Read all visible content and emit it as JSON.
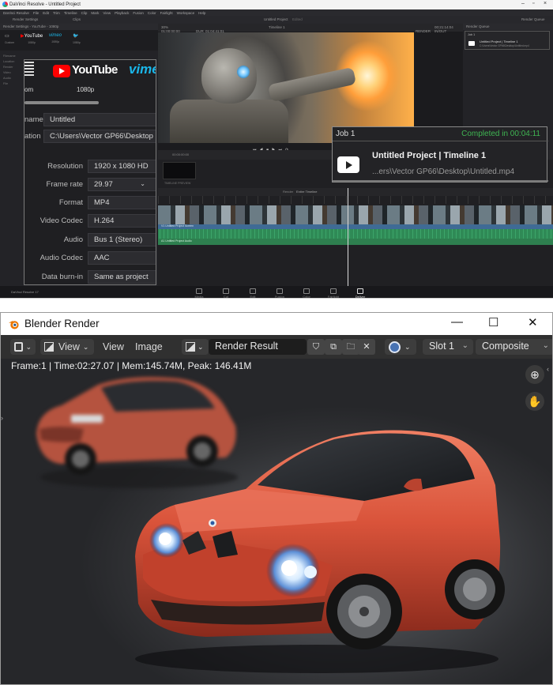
{
  "resolve": {
    "window_title": "DaVinci Resolve - Untitled Project",
    "menu": [
      "DaVinci Resolve",
      "File",
      "Edit",
      "Trim",
      "Timeline",
      "Clip",
      "Mark",
      "View",
      "Playback",
      "Fusion",
      "Color",
      "Fairlight",
      "Workspace",
      "Help"
    ],
    "toolbar": {
      "render_settings": "Render Settings",
      "clips": "Clips",
      "project_title": "Untitled Project",
      "edited": "Edited",
      "render_queue": "Render Queue"
    },
    "left_header": "Render Settings - YouTube - 1080p",
    "presets": [
      {
        "name": "YouTube",
        "sub": "1080p"
      },
      {
        "name": "vimeo",
        "sub": "1080p"
      },
      {
        "name": "Twitter",
        "sub": "1080p"
      }
    ],
    "preset_custom_label": "Custom",
    "left_list": [
      "Filename",
      "Location",
      "Render",
      "Video",
      "Audio",
      "File"
    ],
    "viewer": {
      "zoom": "30%",
      "timeline_name": "Timeline 1",
      "source_tc": "01:00:00:00",
      "duration_label": "DUR",
      "duration_tc": "01:04:41:01",
      "record_tc": "00:21:14:04",
      "render_label": "RENDER",
      "render_range": "IN/OUT",
      "playback_tc": "00:00:00:00"
    },
    "timeline": {
      "scale_label": "Render",
      "range_label": "Entire Timeline",
      "track1": "V1 Untitled Project Screen",
      "track2": "A1 Untitled Project Audio",
      "preview_label": "TIMELINE PREVIEW"
    },
    "queue": {
      "header": "Render Queue",
      "job_name": "Job 1",
      "job_title": "Untitled Project | Timeline 1",
      "job_path": "C:\\Users\\Vector GP66\\Desktop\\Untitled.mp4",
      "job_status": "Completed in 00:04:11"
    },
    "pages": [
      "Media",
      "Cut",
      "Edit",
      "Fusion",
      "Color",
      "Fairlight",
      "Deliver"
    ],
    "status_app": "DaVinci Resolve 17"
  },
  "zoom_settings": {
    "youtube_word": "YouTube",
    "vimeo_word": "vime",
    "sub_left": "om",
    "sub_mid": "1080p",
    "rows": [
      {
        "label": "name",
        "value": "Untitled"
      },
      {
        "label": "ation",
        "value": "C:\\Users\\Vector GP66\\Desktop"
      },
      {
        "label": "Resolution",
        "value": "1920 x 1080 HD"
      },
      {
        "label": "Frame rate",
        "value": "29.97"
      },
      {
        "label": "Format",
        "value": "MP4"
      },
      {
        "label": "Video Codec",
        "value": "H.264"
      },
      {
        "label": "Audio",
        "value": "Bus 1 (Stereo)"
      },
      {
        "label": "Audio Codec",
        "value": "AAC"
      },
      {
        "label": "Data burn-in",
        "value": "Same as project"
      }
    ],
    "frame_rate_caret": "⌄"
  },
  "zoom_job": {
    "name": "Job 1",
    "status": "Completed in 00:04:11",
    "title": "Untitled Project | Timeline 1",
    "path": "...ers\\Vector GP66\\Desktop\\Untitled.mp4"
  },
  "blender": {
    "window_title": "Blender Render",
    "minimize": "—",
    "maximize": "☐",
    "close": "✕",
    "header": {
      "view_menu": "View",
      "view_plain": "View",
      "image_menu": "Image",
      "image_name": "Render Result",
      "slot": "Slot 1",
      "layer": "Composite"
    },
    "stats": "Frame:1 | Time:02:27.07 | Mem:145.74M, Peak: 146.41M",
    "colors": {
      "accent_blue": "#4772b3",
      "yt_red": "#ff0000",
      "completed_green": "#3fb552"
    },
    "icons": [
      "editor-type-icon",
      "image-icon",
      "shield-icon",
      "copy-icon",
      "folder-icon",
      "close-icon",
      "overlay-icon",
      "zoom-icon",
      "hand-icon"
    ]
  }
}
